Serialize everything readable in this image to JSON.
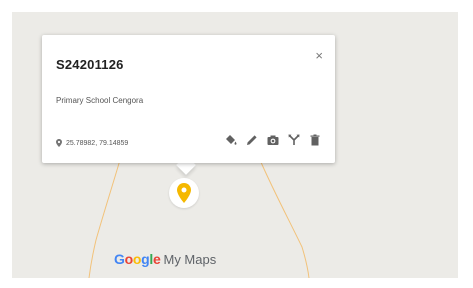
{
  "place": {
    "title": "S24201126",
    "description": "Primary School Cengora",
    "coordinates": "25.78982, 79.14859",
    "close_symbol": "×"
  },
  "toolbar": {
    "icons": [
      "paint-bucket-icon",
      "pencil-icon",
      "camera-icon",
      "directions-icon",
      "trash-icon"
    ]
  },
  "marker": {
    "color": "#f5b800",
    "icon": "map-pin-icon"
  },
  "branding": {
    "google_letters": [
      "G",
      "o",
      "o",
      "g",
      "l",
      "e"
    ],
    "google_colors": [
      "#4285F4",
      "#EA4335",
      "#FBBC05",
      "#4285F4",
      "#34A853",
      "#EA4335"
    ],
    "product": "My Maps"
  },
  "colors": {
    "map_background": "#ecebe7",
    "road": "#f2c27a",
    "icon": "#616161"
  }
}
